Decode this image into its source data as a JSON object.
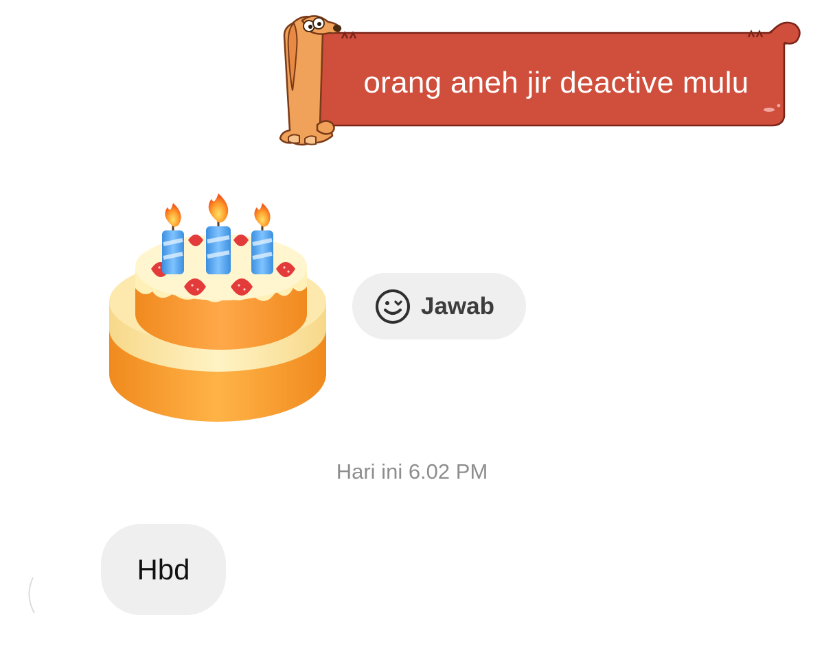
{
  "sent_sticker": {
    "text": "orang aneh jir deactive mulu",
    "banner_color": "#cf4e3c",
    "mascot_icon": "dog-mascot-icon"
  },
  "cake_sticker": {
    "icon": "birthday-cake-icon"
  },
  "reply_button": {
    "icon": "sticker-smiley-icon",
    "label": "Jawab"
  },
  "timestamp": "Hari ini 6.02 PM",
  "received_message": {
    "text": "Hbd",
    "bubble_color": "#efefef"
  }
}
